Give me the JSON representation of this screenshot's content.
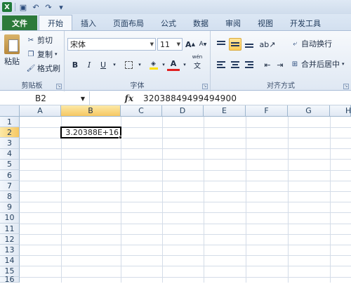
{
  "qat": {
    "undo": "↶",
    "redo": "↷"
  },
  "tabs": [
    "文件",
    "开始",
    "插入",
    "页面布局",
    "公式",
    "数据",
    "审阅",
    "视图",
    "开发工具"
  ],
  "clipboard": {
    "paste": "粘贴",
    "cut": "剪切",
    "copy": "复制",
    "format_painter": "格式刷",
    "label": "剪贴板"
  },
  "font": {
    "name": "宋体",
    "size": "11",
    "grow": "A",
    "shrink": "A",
    "bold": "B",
    "italic": "I",
    "underline": "U",
    "font_color_letter": "A",
    "wen": "wén",
    "label": "字体"
  },
  "alignment": {
    "wrap": "自动换行",
    "merge": "合并后居中",
    "label": "对齐方式"
  },
  "formula_bar": {
    "name_box": "B2",
    "fx": "fx",
    "formula": "32038849499494900"
  },
  "sheet": {
    "columns": [
      "A",
      "B",
      "C",
      "D",
      "E",
      "F",
      "G",
      "H"
    ],
    "rows": [
      "1",
      "2",
      "3",
      "4",
      "5",
      "6",
      "7",
      "8",
      "9",
      "10",
      "11",
      "12",
      "13",
      "14",
      "15",
      "16"
    ],
    "selected_column": "B",
    "selected_row": "2",
    "cell_b2": "3.20388E+16"
  },
  "colors": {
    "file_tab": "#2c7a3a",
    "selection": "#f6c762",
    "header": "#e1e9f4"
  }
}
